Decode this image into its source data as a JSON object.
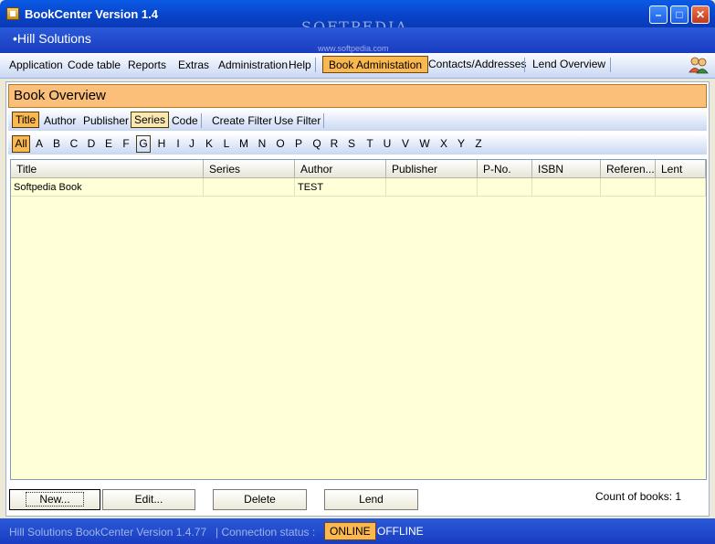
{
  "window": {
    "title": "BookCenter Version 1.4"
  },
  "watermark": {
    "main": "SOFTPEDIA",
    "sub": "www.softpedia.com"
  },
  "header": {
    "company": "Hill Solutions"
  },
  "menu": {
    "items": [
      "Application",
      "Code table",
      "Reports",
      "Extras",
      "Administration",
      "Help"
    ],
    "tabs": [
      "Book Administation",
      "Contacts/Addresses",
      "Lend Overview"
    ],
    "active_tab": "Book Administation"
  },
  "overview": {
    "title": "Book Overview"
  },
  "filters": {
    "sort_options": [
      "Title",
      "Author",
      "Publisher",
      "Series",
      "Code"
    ],
    "selected_sort": "Title",
    "highlighted": "Series",
    "actions": [
      "Create Filter",
      "Use Filter"
    ]
  },
  "alphabet": {
    "letters": [
      "All",
      "A",
      "B",
      "C",
      "D",
      "E",
      "F",
      "G",
      "H",
      "I",
      "J",
      "K",
      "L",
      "M",
      "N",
      "O",
      "P",
      "Q",
      "R",
      "S",
      "T",
      "U",
      "V",
      "W",
      "X",
      "Y",
      "Z"
    ],
    "selected": "All",
    "focused": "G"
  },
  "grid": {
    "columns": [
      "Title",
      "Series",
      "Author",
      "Publisher",
      "P-No.",
      "ISBN",
      "Referen...",
      "Lent"
    ],
    "rows": [
      [
        "Softpedia Book",
        "",
        "TEST",
        "",
        "",
        "",
        "",
        ""
      ]
    ]
  },
  "buttons": {
    "new": "New...",
    "edit": "Edit...",
    "delete": "Delete",
    "lend": "Lend"
  },
  "count": "Count of books: 1",
  "status": {
    "version": "Hill Solutions BookCenter Version 1.4.77",
    "connection_label": "| Connection status :",
    "online": "ONLINE",
    "offline": "OFFLINE"
  },
  "colors": {
    "accent": "#fbb84e",
    "titlebar": "#0842c8",
    "grid_bg": "#ffffd8"
  }
}
